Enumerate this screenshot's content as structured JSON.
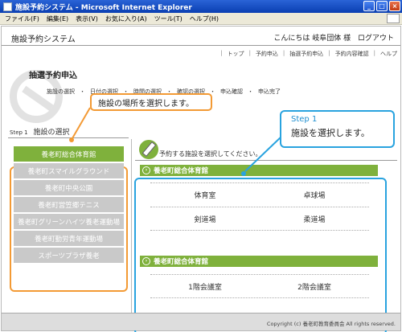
{
  "window": {
    "title": "施設予約システム - Microsoft Internet Explorer",
    "controls": [
      "_",
      "□",
      "×"
    ]
  },
  "menu": [
    "ファイル(F)",
    "編集(E)",
    "表示(V)",
    "お気に入り(A)",
    "ツール(T)",
    "ヘルプ(H)"
  ],
  "header": {
    "app_title": "施設予約システム",
    "greeting": "こんにちは 岐阜団体 様",
    "logout": "ログアウト"
  },
  "topnav": [
    "トップ",
    "予約申込",
    "抽選予約申込",
    "予約内容確認",
    "ヘルプ"
  ],
  "page_heading": "抽選予約申込",
  "steps": [
    "施設の選択",
    "・",
    "日付の選択",
    "・",
    "時間の選択",
    "・",
    "確認の選択",
    "・",
    "申込確認",
    "・",
    "申込完了"
  ],
  "left_section": {
    "step_no": "Step 1",
    "title": "施設の選択",
    "facilities": [
      {
        "label": "養老町総合体育館",
        "active": true
      },
      {
        "label": "養老町スマイルグラウンド",
        "active": false
      },
      {
        "label": "養老町中央公園",
        "active": false
      },
      {
        "label": "養老町営笠郷テニス",
        "active": false
      },
      {
        "label": "養老町グリーンハイツ養老運動場",
        "active": false
      },
      {
        "label": "養老町勤労青年運動場",
        "active": false
      },
      {
        "label": "スポーツプラザ養老",
        "active": false
      }
    ]
  },
  "instruction": "予約する施設を選択してください。",
  "venues": [
    {
      "name": "養老町総合体育館",
      "rooms": [
        [
          "体育室",
          "卓球場"
        ],
        [
          "剣道場",
          "柔道場"
        ]
      ]
    },
    {
      "name": "養老町総合体育館",
      "rooms": [
        [
          "1階会議室",
          "2階会議室"
        ]
      ]
    }
  ],
  "callouts": {
    "left": "施設の場所を選択します。",
    "right_step": "Step 1",
    "right_text": "施設を選択します。"
  },
  "footer": {
    "copyright": "Copyright (c) 養老町教育委員会 All rights reserved."
  },
  "colors": {
    "accent_green": "#7fb13c",
    "callout_orange": "#f39a34",
    "callout_blue": "#29a3df"
  }
}
